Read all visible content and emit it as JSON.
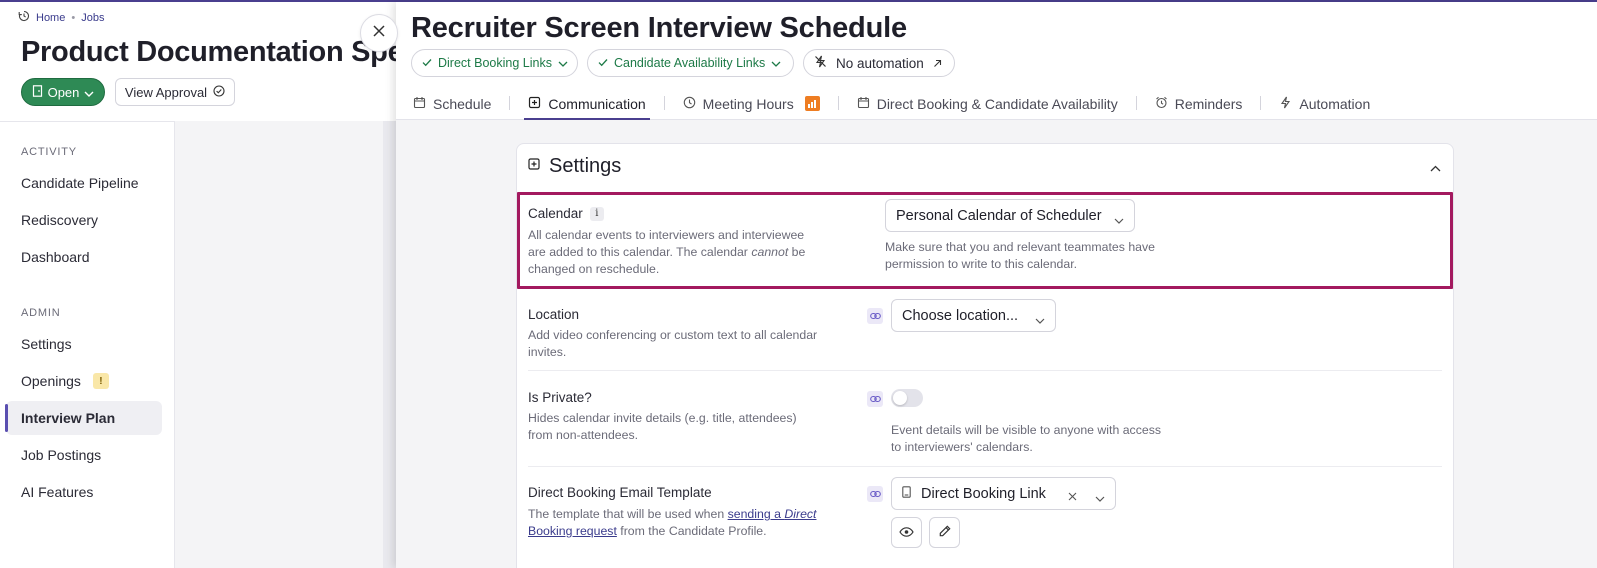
{
  "breadcrumb": {
    "home": "Home",
    "jobs": "Jobs"
  },
  "job": {
    "title": "Product Documentation Specialist",
    "status_button": "Open",
    "view_approval": "View Approval"
  },
  "left_nav": {
    "activity_heading": "ACTIVITY",
    "admin_heading": "ADMIN",
    "items": [
      {
        "label": "Candidate Pipeline"
      },
      {
        "label": "Rediscovery"
      },
      {
        "label": "Dashboard"
      },
      {
        "label": "Settings"
      },
      {
        "label": "Openings",
        "badge": "!"
      },
      {
        "label": "Interview Plan",
        "active": true
      },
      {
        "label": "Job Postings"
      },
      {
        "label": "AI Features"
      }
    ]
  },
  "panel": {
    "title": "Recruiter Screen Interview Schedule",
    "pills": {
      "direct_booking": "Direct Booking Links",
      "candidate_availability": "Candidate Availability Links",
      "automation": "No automation"
    },
    "tabs": [
      {
        "label": "Schedule",
        "icon": "calendar-icon"
      },
      {
        "label": "Communication",
        "icon": "message-icon",
        "active": true
      },
      {
        "label": "Meeting Hours",
        "icon": "clock-icon"
      },
      {
        "label": "Direct Booking & Candidate Availability",
        "icon": "calendar-icon"
      },
      {
        "label": "Reminders",
        "icon": "alarm-icon"
      },
      {
        "label": "Automation",
        "icon": "bolt-icon"
      }
    ]
  },
  "settings": {
    "title": "Settings",
    "calendar": {
      "label": "Calendar",
      "info": "i",
      "desc_1": "All calendar events to interviewers and interviewee",
      "desc_2": "are added to this calendar. The calendar ",
      "desc_em": "cannot",
      "desc_3": " be",
      "desc_4": "changed on reschedule.",
      "value": "Personal Calendar of Scheduler",
      "hint_1": "Make sure that you and relevant teammates have",
      "hint_2": "permission to write to this calendar."
    },
    "location": {
      "label": "Location",
      "desc_1": "Add video conferencing or custom text to all calendar",
      "desc_2": "invites.",
      "placeholder": "Choose location..."
    },
    "is_private": {
      "label": "Is Private?",
      "desc_1": "Hides calendar invite details (e.g. title, attendees)",
      "desc_2": "from non-attendees.",
      "enabled": false,
      "hint_1": "Event details will be visible to anyone with access",
      "hint_2": "to interviewers' calendars."
    },
    "email_template": {
      "label": "Direct Booking Email Template",
      "desc_pre": "The template that will be used when ",
      "desc_link_1": "sending a ",
      "desc_link_em": "Direct",
      "desc_link_2": "Booking request",
      "desc_post": " from the Candidate Profile.",
      "value": "Direct Booking Link"
    }
  },
  "colors": {
    "accent": "#4a3f8f",
    "open_green": "#2e8a55",
    "highlight": "#a3195f",
    "orange_badge": "#ee7d22"
  }
}
